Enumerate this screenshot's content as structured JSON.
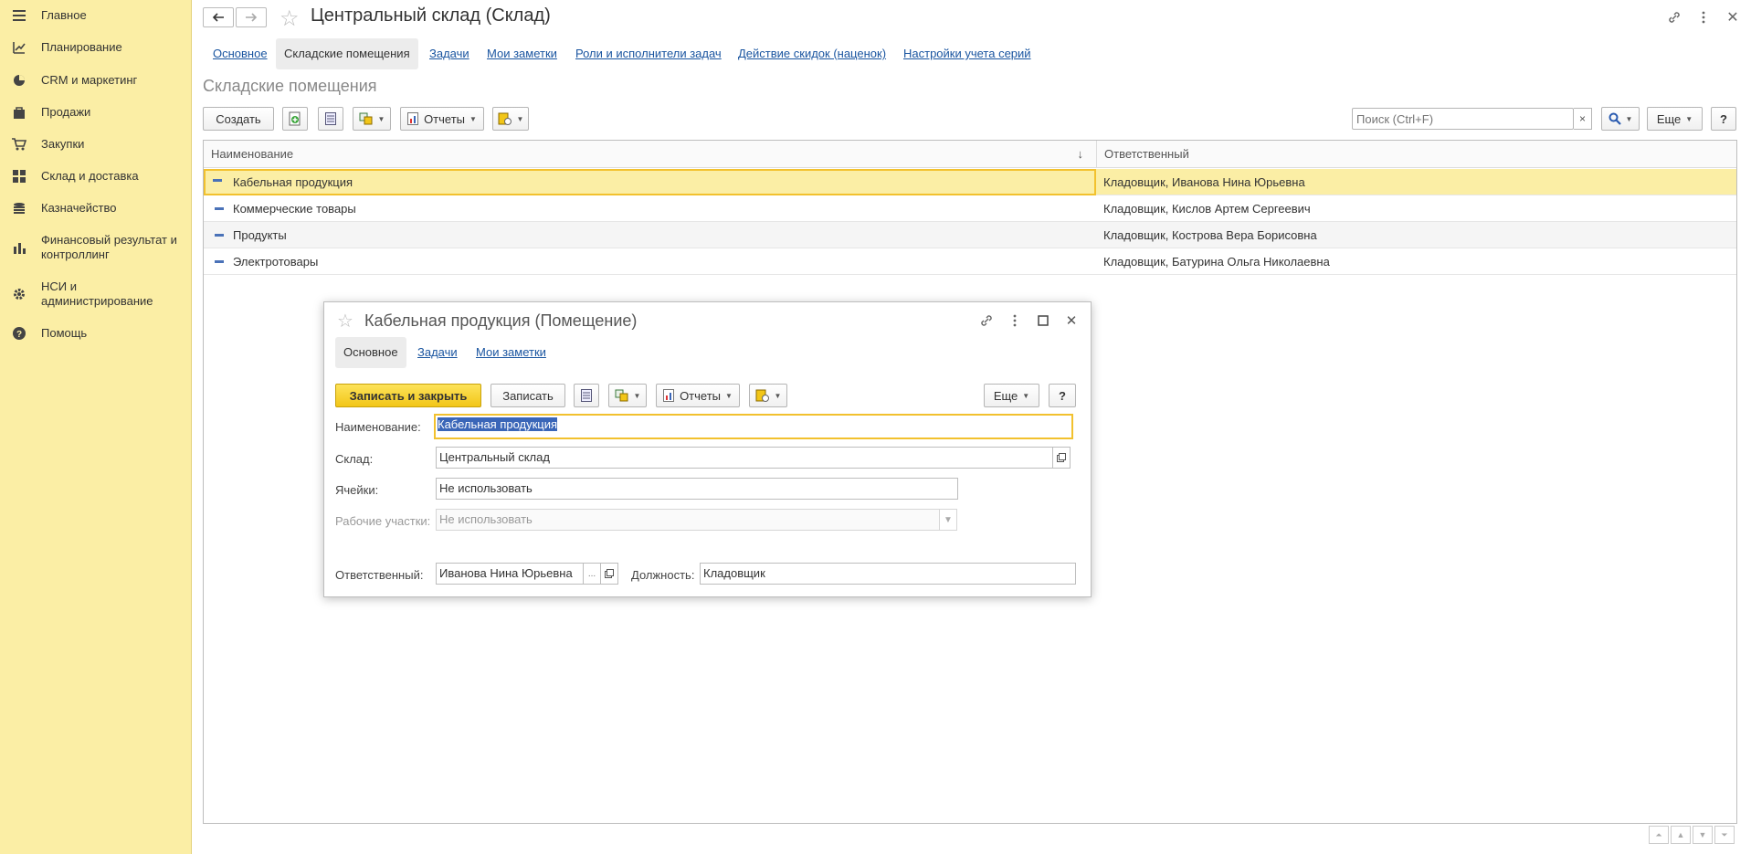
{
  "sidebar": {
    "items": [
      {
        "label": "Главное",
        "icon": "menu-icon"
      },
      {
        "label": "Планирование",
        "icon": "planning-icon"
      },
      {
        "label": "CRM и маркетинг",
        "icon": "pie-chart-icon"
      },
      {
        "label": "Продажи",
        "icon": "bag-icon"
      },
      {
        "label": "Закупки",
        "icon": "cart-icon"
      },
      {
        "label": "Склад и доставка",
        "icon": "warehouse-grid-icon"
      },
      {
        "label": "Казначейство",
        "icon": "coins-icon"
      },
      {
        "label": "Финансовый результат и контроллинг",
        "icon": "bar-chart-icon"
      },
      {
        "label": "НСИ и администрирование",
        "icon": "gear-icon"
      },
      {
        "label": "Помощь",
        "icon": "help-circle-icon"
      }
    ]
  },
  "header": {
    "title": "Центральный склад (Склад)",
    "tabs": [
      {
        "label": "Основное"
      },
      {
        "label": "Складские помещения",
        "active": true
      },
      {
        "label": "Задачи"
      },
      {
        "label": "Мои заметки"
      },
      {
        "label": "Роли и исполнители задач"
      },
      {
        "label": "Действие скидок (наценок)"
      },
      {
        "label": "Настройки учета серий"
      }
    ]
  },
  "section": {
    "title": "Складские помещения",
    "create_label": "Создать",
    "reports_label": "Отчеты",
    "more_label": "Еще",
    "help_label": "?",
    "search_placeholder": "Поиск (Ctrl+F)",
    "search_clear": "×"
  },
  "table": {
    "columns": [
      "Наименование",
      "Ответственный"
    ],
    "sort_indicator": "↓",
    "rows": [
      {
        "name": "Кабельная продукция",
        "responsible": "Кладовщик, Иванова Нина Юрьевна",
        "selected": true
      },
      {
        "name": "Коммерческие товары",
        "responsible": "Кладовщик, Кислов Артем Сергеевич"
      },
      {
        "name": "Продукты",
        "responsible": "Кладовщик, Кострова Вера Борисовна"
      },
      {
        "name": "Электротовары",
        "responsible": "Кладовщик, Батурина Ольга Николаевна"
      }
    ]
  },
  "dialog": {
    "title": "Кабельная продукция (Помещение)",
    "tabs": [
      {
        "label": "Основное",
        "active": true
      },
      {
        "label": "Задачи"
      },
      {
        "label": "Мои заметки"
      }
    ],
    "save_close_label": "Записать и закрыть",
    "save_label": "Записать",
    "reports_label": "Отчеты",
    "more_label": "Еще",
    "help_label": "?",
    "fields": {
      "name_label": "Наименование:",
      "name_value": "Кабельная продукция",
      "warehouse_label": "Склад:",
      "warehouse_value": "Центральный склад",
      "cells_label": "Ячейки:",
      "cells_value": "Не использовать",
      "work_areas_label": "Рабочие участки:",
      "work_areas_value": "Не использовать",
      "responsible_label": "Ответственный:",
      "responsible_value": "Иванова Нина Юрьевна",
      "responsible_select": "...",
      "position_label": "Должность:",
      "position_value": "Кладовщик"
    }
  },
  "colors": {
    "sidebar_bg": "#fbeea5",
    "accent_yellow": "#f2c618",
    "link_blue": "#1a55a0",
    "selection_blue": "#3a66b8"
  }
}
